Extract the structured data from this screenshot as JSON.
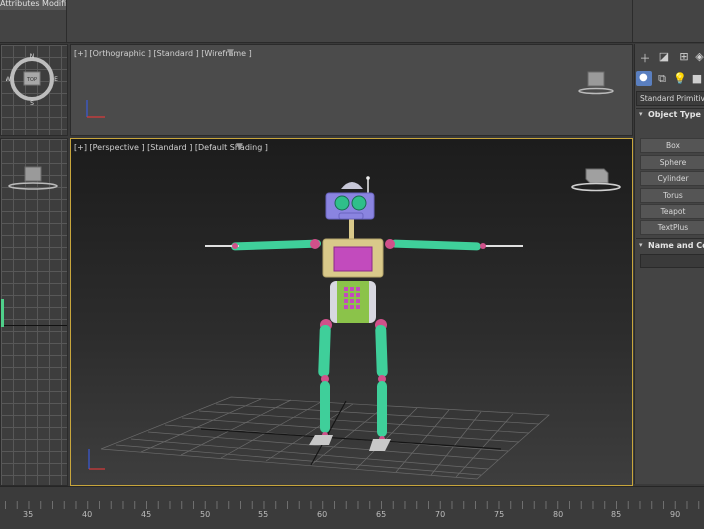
{
  "modifier_tab": {
    "label": "Attributes Modifier"
  },
  "viewport_top": {
    "label": "[+] [Orthographic ] [Standard ] [Wireframe ]",
    "viewcube_label": "front"
  },
  "viewport_topleft": {
    "compass": {
      "n": "N",
      "s": "S",
      "e": "E",
      "w": "W",
      "center": "TOP"
    }
  },
  "viewport_left": {
    "viewcube_label": "left"
  },
  "viewport_perspective": {
    "label": "[+] [Perspective ] [Standard ] [Default Shading ]",
    "viewcube_label": "front"
  },
  "command_panel": {
    "tabs": [
      "plus-icon",
      "modify-icon",
      "hierarchy-icon",
      "motion-icon"
    ],
    "subtabs": [
      "geometry-icon",
      "shapes-icon",
      "lights-icon",
      "cameras-icon"
    ],
    "category_dropdown": "Standard Primitives",
    "object_type_header": "Object Type",
    "primitives": [
      "Box",
      "Sphere",
      "Cylinder",
      "Torus",
      "Teapot",
      "TextPlus"
    ],
    "name_color_header": "Name and Color"
  },
  "timeline": {
    "ticks": [
      "35",
      "40",
      "45",
      "50",
      "55",
      "60",
      "65",
      "70",
      "75",
      "80",
      "85",
      "90"
    ]
  },
  "colors": {
    "viewport_active_border": "#c8a63c",
    "robot_limb": "#3fcf9a",
    "robot_joint": "#d0508a",
    "robot_head": "#8a84e0",
    "robot_chest": "#d9c98a",
    "robot_screen": "#c24bbd",
    "robot_belly": "#8bc34a"
  }
}
